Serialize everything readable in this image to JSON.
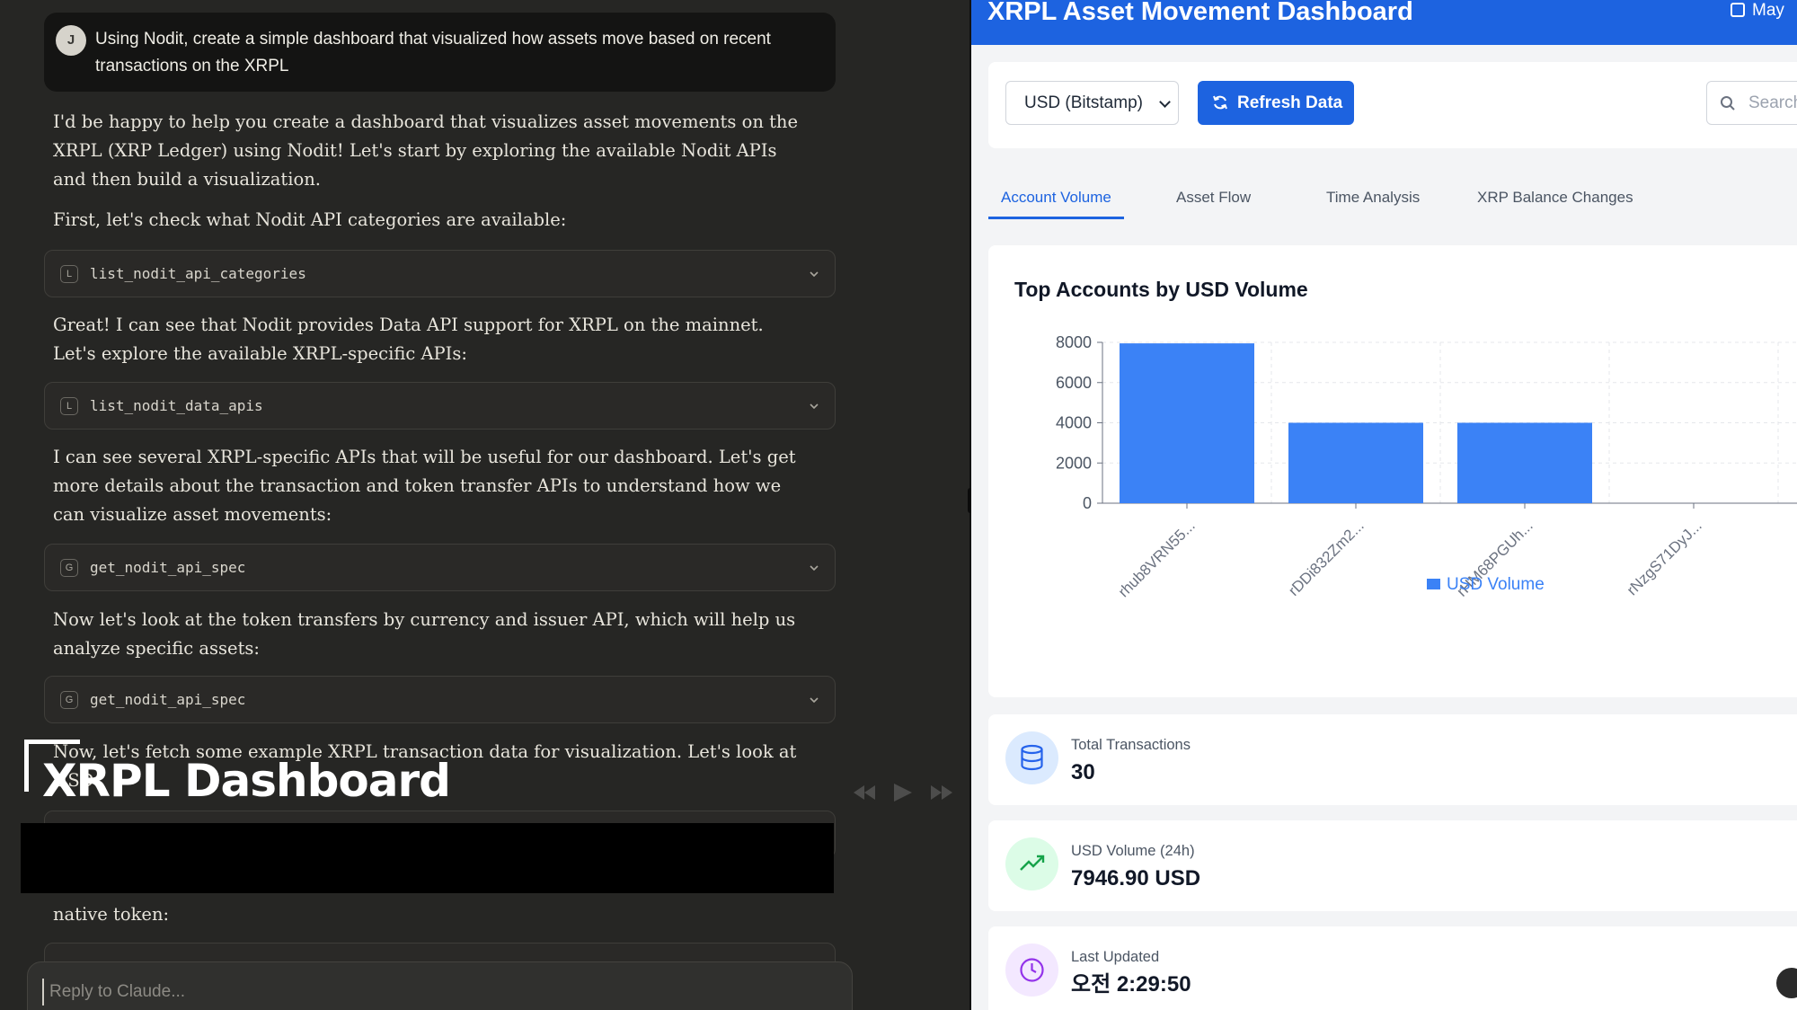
{
  "chat": {
    "user_avatar": "J",
    "user_message": "Using Nodit, create a simple dashboard that visualized how assets move based on recent transactions on the XRPL",
    "paragraphs": [
      "I'd be happy to help you create a dashboard that visualizes asset movements on the XRPL (XRP Ledger) using Nodit! Let's start by exploring the available Nodit APIs and then build a visualization.",
      "First, let's check what Nodit API categories are available:",
      "Great! I can see that Nodit provides Data API support for XRPL on the mainnet. Let's explore the available XRPL-specific APIs:",
      "I can see several XRPL-specific APIs that will be useful for our dashboard. Let's get more details about the transaction and token transfer APIs to understand how we can visualize asset movements:",
      "Now let's look at the token transfers by currency and issuer API, which will help us analyze specific assets:",
      "Now, let's fetch some example XRPL transaction data for visualization. Let's look at USD",
      "native token:"
    ],
    "tools": [
      {
        "icon": "L",
        "label": "list_nodit_api_categories"
      },
      {
        "icon": "L",
        "label": "list_nodit_data_apis"
      },
      {
        "icon": "G",
        "label": "get_nodit_api_spec"
      },
      {
        "icon": "G",
        "label": "get_nodit_api_spec"
      }
    ],
    "overlay_title": "XRPL Dashboard",
    "reply_placeholder": "Reply to Claude..."
  },
  "dashboard": {
    "title": "XRPL Asset Movement Dashboard",
    "date": "May",
    "currency_select": {
      "value": "USD (Bitstamp)",
      "options": [
        "USD (Bitstamp)"
      ]
    },
    "refresh_label": "Refresh Data",
    "search_placeholder": "Search",
    "tabs": [
      "Account Volume",
      "Asset Flow",
      "Time Analysis",
      "XRP Balance Changes"
    ],
    "active_tab": "Account Volume",
    "stats": [
      {
        "label": "Total Transactions",
        "value": "30",
        "icon": "database-icon"
      },
      {
        "label": "USD Volume (24h)",
        "value": "7946.90 USD",
        "icon": "trending-up-icon"
      },
      {
        "label": "Last Updated",
        "value": "오전 2:29:50",
        "icon": "clock-icon"
      }
    ],
    "colors": {
      "brand": "#1d63e0",
      "bar": "#3b82f6"
    }
  },
  "chart_data": {
    "type": "bar",
    "title": "Top Accounts by USD Volume",
    "categories": [
      "rhub8VRN55...",
      "rDDi832Zm2...",
      "rHM68PGUh...",
      "rNzgS71DyJ..."
    ],
    "series": [
      {
        "name": "USD Volume",
        "values": [
          7950,
          4000,
          4000,
          0
        ]
      }
    ],
    "yticks": [
      0,
      2000,
      4000,
      6000,
      8000
    ],
    "ylim": [
      0,
      8000
    ],
    "grid": true,
    "legend": "bottom"
  }
}
